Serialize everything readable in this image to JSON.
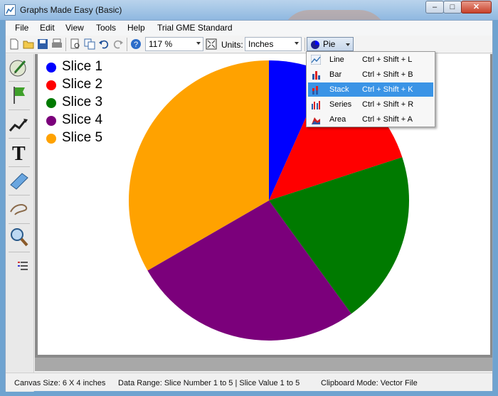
{
  "window": {
    "title": "Graphs Made Easy (Basic)"
  },
  "menu": {
    "items": [
      "File",
      "Edit",
      "View",
      "Tools",
      "Help",
      "Trial GME Standard"
    ]
  },
  "toolbar": {
    "zoom_value": "117 %",
    "units_label": "Units:",
    "units_value": "Inches",
    "chart_type_label": "Pie"
  },
  "chart_type_menu": {
    "items": [
      {
        "label": "Line",
        "shortcut": "Ctrl + Shift + L",
        "icon": "line-chart-icon",
        "highlighted": false
      },
      {
        "label": "Bar",
        "shortcut": "Ctrl + Shift + B",
        "icon": "bar-chart-icon",
        "highlighted": false
      },
      {
        "label": "Stack",
        "shortcut": "Ctrl + Shift + K",
        "icon": "stacked-bar-icon",
        "highlighted": true
      },
      {
        "label": "Series",
        "shortcut": "Ctrl + Shift + R",
        "icon": "series-chart-icon",
        "highlighted": false
      },
      {
        "label": "Area",
        "shortcut": "Ctrl + Shift + A",
        "icon": "area-chart-icon",
        "highlighted": false
      }
    ]
  },
  "status": {
    "canvas_size": "Canvas Size:  6 X 4  inches",
    "data_range": "Data Range:  Slice Number 1 to 5  |  Slice Value 1 to 5",
    "clipboard_mode": "Clipboard Mode: Vector File"
  },
  "chart_data": {
    "type": "pie",
    "title": "",
    "categories": [
      "Slice 1",
      "Slice 2",
      "Slice 3",
      "Slice 4",
      "Slice 5"
    ],
    "values": [
      1,
      2,
      3,
      4,
      5
    ],
    "colors": [
      "#0000ff",
      "#ff0000",
      "#007a00",
      "#7b007b",
      "#ffa200"
    ],
    "legend": "top-left"
  }
}
